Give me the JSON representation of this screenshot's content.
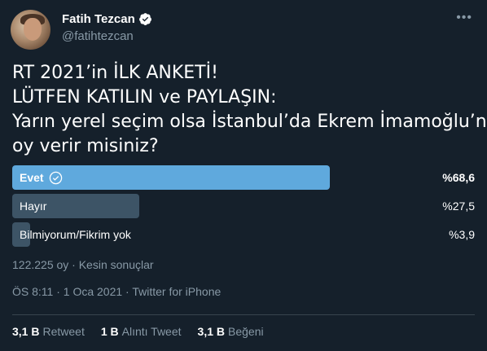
{
  "user": {
    "display_name": "Fatih Tezcan",
    "handle": "@fatihtezcan",
    "verified": true
  },
  "tweet": {
    "lines": [
      "RT 2021’in İLK ANKETİ!",
      "LÜTFEN KATILIN ve PAYLAŞIN:",
      "Yarın yerel seçim olsa İstanbul’da Ekrem İmamoğlu’na",
      "oy verir misiniz?"
    ]
  },
  "poll": {
    "options": [
      {
        "label": "Evet",
        "percent_text": "%68,6",
        "percent": 68.6,
        "winner": true
      },
      {
        "label": "Hayır",
        "percent_text": "%27,5",
        "percent": 27.5,
        "winner": false
      },
      {
        "label": "Bilmiyorum/Fikrim yok",
        "percent_text": "%3,9",
        "percent": 3.9,
        "winner": false
      }
    ],
    "meta": "122.225 oy · Kesin sonuçlar"
  },
  "meta": "ÖS 8:11 · 1 Oca 2021 · Twitter for iPhone",
  "stats": [
    {
      "count": "3,1 B",
      "label": "Retweet"
    },
    {
      "count": "1 B",
      "label": "Alıntı Tweet"
    },
    {
      "count": "3,1 B",
      "label": "Beğeni"
    }
  ],
  "colors": {
    "background": "#15202b",
    "winner_bar": "#5fa9dd",
    "other_bar": "#3d5466",
    "secondary_text": "#8899a6"
  }
}
